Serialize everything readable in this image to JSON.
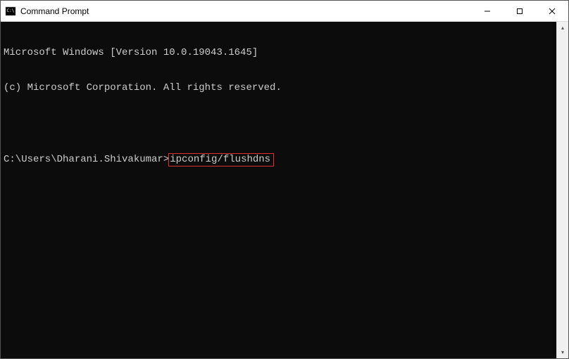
{
  "window": {
    "title": "Command Prompt"
  },
  "terminal": {
    "line1": "Microsoft Windows [Version 10.0.19043.1645]",
    "line2": "(c) Microsoft Corporation. All rights reserved.",
    "prompt": "C:\\Users\\Dharani.Shivakumar>",
    "command": "ipconfig/flushdns"
  },
  "controls": {
    "minimize": "─",
    "maximize": "☐",
    "close": "✕"
  },
  "scrollbar": {
    "up": "▴",
    "down": "▾"
  }
}
